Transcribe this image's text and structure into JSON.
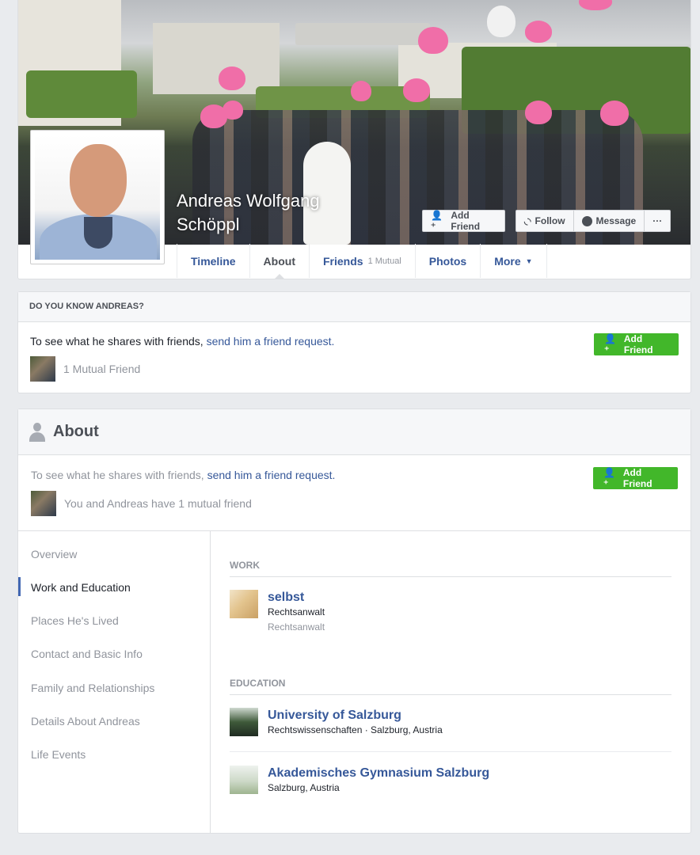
{
  "profile": {
    "name": "Andreas Wolfgang Schöppl",
    "buttons": {
      "add_friend": "Add Friend",
      "follow": "Follow",
      "message": "Message",
      "more": "···"
    },
    "tabs": [
      {
        "label": "Timeline"
      },
      {
        "label": "About"
      },
      {
        "label": "Friends",
        "sub": "1 Mutual"
      },
      {
        "label": "Photos"
      },
      {
        "label": "More"
      }
    ]
  },
  "know": {
    "header": "DO YOU KNOW ANDREAS?",
    "text": "To see what he shares with friends, ",
    "link": "send him a friend request.",
    "mutual": "1 Mutual Friend",
    "button": "Add Friend"
  },
  "about": {
    "title": "About",
    "intro_text": "To see what he shares with friends, ",
    "intro_link": "send him a friend request.",
    "mutual": "You and Andreas have 1 mutual friend",
    "button": "Add Friend",
    "nav": [
      "Overview",
      "Work and Education",
      "Places He's Lived",
      "Contact and Basic Info",
      "Family and Relationships",
      "Details About Andreas",
      "Life Events"
    ],
    "work": {
      "title": "WORK",
      "items": [
        {
          "name": "selbst",
          "sub": "Rechtsanwalt",
          "sub2": "Rechtsanwalt"
        }
      ]
    },
    "education": {
      "title": "EDUCATION",
      "items": [
        {
          "name": "University of Salzburg",
          "sub": "Rechtswissenschaften · Salzburg, Austria"
        },
        {
          "name": "Akademisches Gymnasium Salzburg",
          "sub": "Salzburg, Austria"
        }
      ]
    }
  },
  "colors": {
    "link": "#365899",
    "green": "#42b72a",
    "accent": "#4267b2"
  }
}
